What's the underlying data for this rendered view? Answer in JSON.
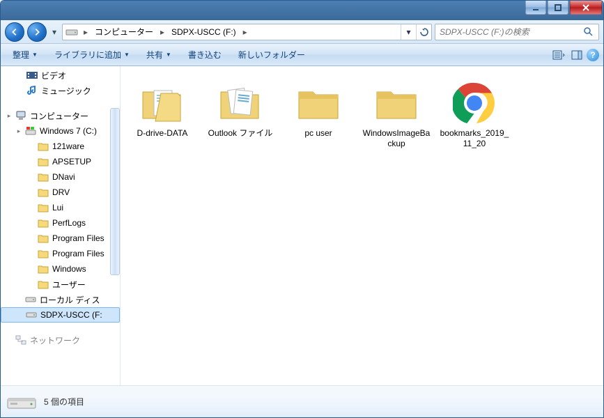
{
  "breadcrumb": {
    "seg1": "コンピューター",
    "seg2": "SDPX-USCC (F:)"
  },
  "search": {
    "placeholder": "SDPX-USCC (F:)の検索"
  },
  "toolbar": {
    "organize": "整理",
    "library": "ライブラリに追加",
    "share": "共有",
    "burn": "書き込む",
    "newfolder": "新しいフォルダー"
  },
  "tree": {
    "videos": "ビデオ",
    "music": "ミュージック",
    "computer": "コンピューター",
    "win7": "Windows 7 (C:)",
    "c_items": [
      "121ware",
      "APSETUP",
      "DNavi",
      "DRV",
      "Lui",
      "PerfLogs",
      "Program Files",
      "Program Files",
      "Windows",
      "ユーザー"
    ],
    "localdisk": "ローカル ディス",
    "sdpx": "SDPX-USCC (F:",
    "network": "ネットワーク"
  },
  "items": [
    {
      "name": "D-drive-DATA",
      "type": "folder-docs"
    },
    {
      "name": "Outlook ファイル",
      "type": "folder-files"
    },
    {
      "name": "pc user",
      "type": "folder"
    },
    {
      "name": "WindowsImageBackup",
      "type": "folder"
    },
    {
      "name": "bookmarks_2019_11_20",
      "type": "chrome"
    }
  ],
  "status": {
    "text": "5 個の項目"
  }
}
